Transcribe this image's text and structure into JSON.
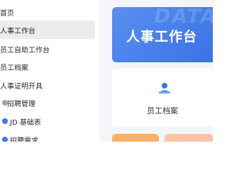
{
  "sidebar": {
    "items": [
      {
        "label": "首页"
      },
      {
        "label": "人事工作台"
      },
      {
        "label": "员工自助工作台"
      },
      {
        "label": "员工档案"
      },
      {
        "label": "人事证明开具"
      },
      {
        "label": "招聘管理"
      },
      {
        "label": "JD 基础表"
      },
      {
        "label": "招聘需求"
      }
    ]
  },
  "main": {
    "banner": {
      "title": "人事工作台",
      "watermark": "DATA"
    },
    "archive_card": {
      "label": "员工档案",
      "icon": "person-archive-icon"
    }
  },
  "colors": {
    "accent": "#3a73e6",
    "active_bg": "#ececec",
    "orange": "#f6b26b",
    "peach": "#f7c6a6"
  }
}
